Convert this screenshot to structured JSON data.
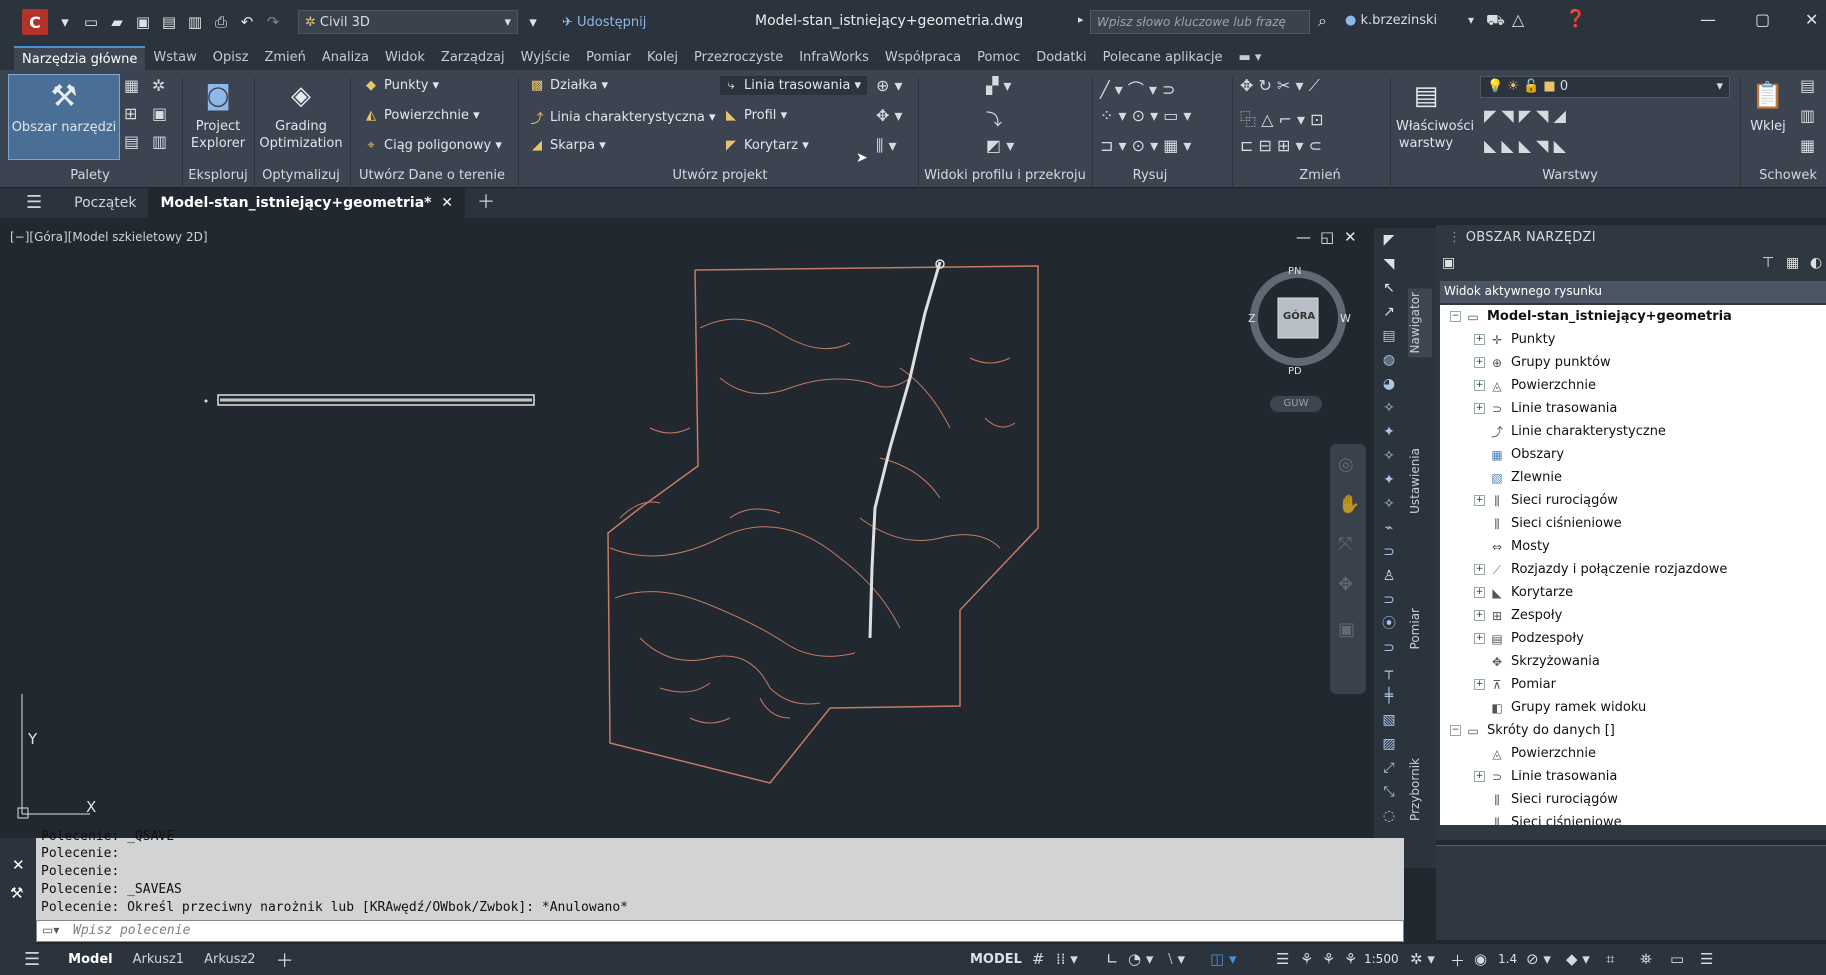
{
  "titlebar": {
    "logo": "C",
    "workspace": "Civil 3D",
    "share": "Udostępnij",
    "document": "Model-stan_istniejący+geometria.dwg",
    "search_placeholder": "Wpisz słowo kluczowe lub frazę",
    "user": "k.brzezinski"
  },
  "ribbon_tabs": [
    "Narzędzia główne",
    "Wstaw",
    "Opisz",
    "Zmień",
    "Analiza",
    "Widok",
    "Zarządzaj",
    "Wyjście",
    "Pomiar",
    "Kolej",
    "Przezroczyste",
    "InfraWorks",
    "Współpraca",
    "Pomoc",
    "Dodatki",
    "Polecane aplikacje"
  ],
  "ribbon": {
    "palettes": {
      "big_button": "Obszar narzędzi",
      "label": "Palety"
    },
    "explore": {
      "button_line1": "Project",
      "button_line2": "Explorer",
      "label": "Eksploruj"
    },
    "optimize": {
      "button_line1": "Grading",
      "button_line2": "Optimization",
      "label": "Optymalizuj"
    },
    "ground": {
      "items": [
        "Punkty",
        "Powierzchnie",
        "Ciąg poligonowy"
      ],
      "label": "Utwórz Dane o terenie"
    },
    "design": {
      "col1": [
        "Działka",
        "Linia charakterystyczna",
        "Skarpa"
      ],
      "col2": [
        "Linia trasowania",
        "Profil",
        "Korytarz"
      ],
      "label": "Utwórz projekt"
    },
    "profile_views": {
      "label": "Widoki profilu i przekroju"
    },
    "draw": {
      "label": "Rysuj"
    },
    "modify": {
      "label": "Zmień"
    },
    "layers": {
      "button_line1": "Właściwości",
      "button_line2": "warstwy",
      "layer_value": "0",
      "label": "Warstwy"
    },
    "clipboard": {
      "button": "Wklej",
      "label": "Schowek"
    }
  },
  "doc_tabs": [
    "Początek",
    "Model-stan_istniejący+geometria*"
  ],
  "viewport": {
    "label": "[−][Góra][Model szkieletowy 2D]",
    "viewcube": {
      "top": "GÓRA",
      "north": "PN",
      "south": "PD",
      "west": "Z",
      "east": "W",
      "ucs": "GUW"
    },
    "ucs_x": "X",
    "ucs_y": "Y"
  },
  "side_tabs": [
    "Nawigator",
    "Ustawienia",
    "Pomiar",
    "Przybornik"
  ],
  "toolspace": {
    "title": "OBSZAR NARZĘDZI",
    "view_select": "Widok aktywnego rysunku",
    "root": "Model-stan_istniejący+geometria",
    "items": [
      "Punkty",
      "Grupy punktów",
      "Powierzchnie",
      "Linie trasowania",
      "Linie charakterystyczne",
      "Obszary",
      "Zlewnie",
      "Sieci rurociągów",
      "Sieci ciśnieniowe",
      "Mosty",
      "Rozjazdy i połączenie rozjazdowe",
      "Korytarze",
      "Zespoły",
      "Podzespoły",
      "Skrzyżowania",
      "Pomiar",
      "Grupy ramek widoku"
    ],
    "shortcuts_root": "Skróty do danych []",
    "shortcut_items": [
      "Powierzchnie",
      "Linie trasowania",
      "Sieci rurociągów",
      "Sieci ciśnieniowe"
    ]
  },
  "command": {
    "history": [
      "Polecenie: _QSAVE",
      "Polecenie:",
      "Polecenie:",
      "Polecenie: _SAVEAS",
      "Polecenie: Określ przeciwny narożnik lub [KRAwędź/OWbok/Zwbok]: *Anulowano*"
    ],
    "placeholder": "Wpisz polecenie"
  },
  "status": {
    "layout_tabs": [
      "Model",
      "Arkusz1",
      "Arkusz2"
    ],
    "space": "MODEL",
    "scale": "1:500",
    "annotation": "1.4"
  },
  "colors": {
    "drawing_line": "#c47a63",
    "alignment": "#e0e0e0",
    "accent": "#4a90d9"
  }
}
